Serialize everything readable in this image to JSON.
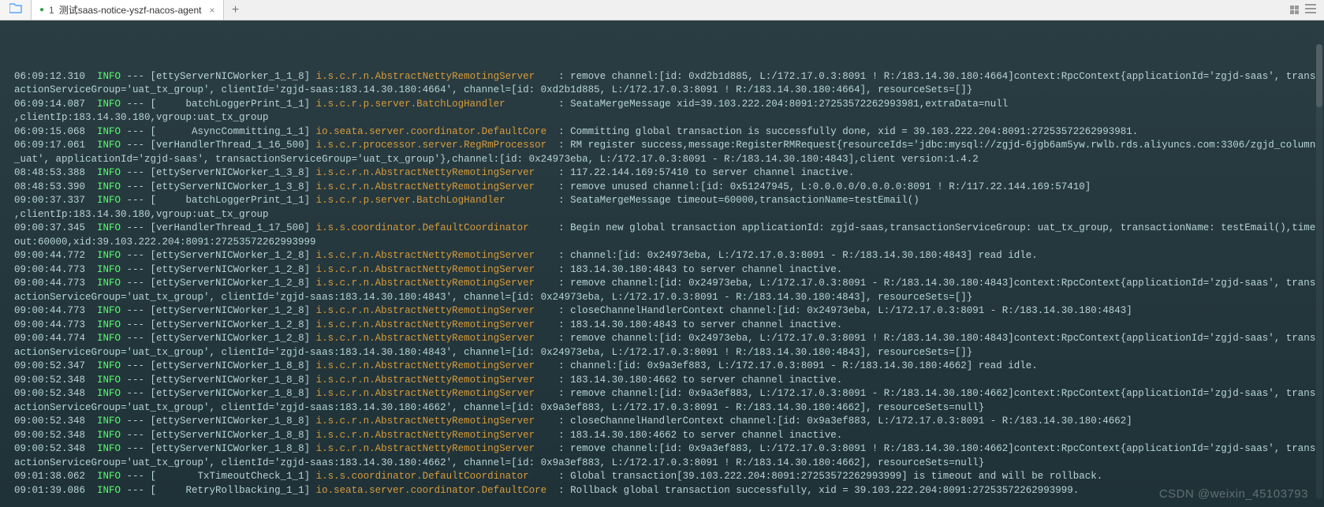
{
  "tab": {
    "badge": "1",
    "title": "测试saas-notice-yszf-nacos-agent"
  },
  "watermark": "CSDN @weixin_45103793",
  "logs": [
    {
      "ts": "06:09:12.310",
      "lvl": "INFO",
      "thr": "[ettyServerNICWorker_1_1_8]",
      "cls": "i.s.c.r.n.AbstractNettyRemotingServer",
      "msg": ": remove channel:[id: 0xd2b1d885, L:/172.17.0.3:8091 ! R:/183.14.30.180:4664]context:RpcContext{applicationId='zgjd-saas', transactionServiceGroup='uat_tx_group', clientId='zgjd-saas:183.14.30.180:4664', channel=[id: 0xd2b1d885, L:/172.17.0.3:8091 ! R:/183.14.30.180:4664], resourceSets=[]}"
    },
    {
      "ts": "06:09:14.087",
      "lvl": "INFO",
      "thr": "[     batchLoggerPrint_1_1]",
      "cls": "i.s.c.r.p.server.BatchLogHandler",
      "msg": ": SeataMergeMessage xid=39.103.222.204:8091:27253572262993981,extraData=null\n,clientIp:183.14.30.180,vgroup:uat_tx_group"
    },
    {
      "ts": "06:09:15.068",
      "lvl": "INFO",
      "thr": "[      AsyncCommitting_1_1]",
      "cls": "io.seata.server.coordinator.DefaultCore",
      "msg": ": Committing global transaction is successfully done, xid = 39.103.222.204:8091:27253572262993981."
    },
    {
      "ts": "06:09:17.061",
      "lvl": "INFO",
      "thr": "[verHandlerThread_1_16_500]",
      "cls": "i.s.c.r.processor.server.RegRmProcessor",
      "msg": ": RM register success,message:RegisterRMRequest{resourceIds='jdbc:mysql://zgjd-6jgb6am5yw.rwlb.rds.aliyuncs.com:3306/zgjd_column_uat', applicationId='zgjd-saas', transactionServiceGroup='uat_tx_group'},channel:[id: 0x24973eba, L:/172.17.0.3:8091 - R:/183.14.30.180:4843],client version:1.4.2"
    },
    {
      "ts": "08:48:53.388",
      "lvl": "INFO",
      "thr": "[ettyServerNICWorker_1_3_8]",
      "cls": "i.s.c.r.n.AbstractNettyRemotingServer",
      "msg": ": 117.22.144.169:57410 to server channel inactive."
    },
    {
      "ts": "08:48:53.390",
      "lvl": "INFO",
      "thr": "[ettyServerNICWorker_1_3_8]",
      "cls": "i.s.c.r.n.AbstractNettyRemotingServer",
      "msg": ": remove unused channel:[id: 0x51247945, L:0.0.0.0/0.0.0.0:8091 ! R:/117.22.144.169:57410]"
    },
    {
      "ts": "09:00:37.337",
      "lvl": "INFO",
      "thr": "[     batchLoggerPrint_1_1]",
      "cls": "i.s.c.r.p.server.BatchLogHandler",
      "msg": ": SeataMergeMessage timeout=60000,transactionName=testEmail()\n,clientIp:183.14.30.180,vgroup:uat_tx_group"
    },
    {
      "ts": "09:00:37.345",
      "lvl": "INFO",
      "thr": "[verHandlerThread_1_17_500]",
      "cls": "i.s.s.coordinator.DefaultCoordinator",
      "msg": ": Begin new global transaction applicationId: zgjd-saas,transactionServiceGroup: uat_tx_group, transactionName: testEmail(),timeout:60000,xid:39.103.222.204:8091:27253572262993999"
    },
    {
      "ts": "09:00:44.772",
      "lvl": "INFO",
      "thr": "[ettyServerNICWorker_1_2_8]",
      "cls": "i.s.c.r.n.AbstractNettyRemotingServer",
      "msg": ": channel:[id: 0x24973eba, L:/172.17.0.3:8091 - R:/183.14.30.180:4843] read idle."
    },
    {
      "ts": "09:00:44.773",
      "lvl": "INFO",
      "thr": "[ettyServerNICWorker_1_2_8]",
      "cls": "i.s.c.r.n.AbstractNettyRemotingServer",
      "msg": ": 183.14.30.180:4843 to server channel inactive."
    },
    {
      "ts": "09:00:44.773",
      "lvl": "INFO",
      "thr": "[ettyServerNICWorker_1_2_8]",
      "cls": "i.s.c.r.n.AbstractNettyRemotingServer",
      "msg": ": remove channel:[id: 0x24973eba, L:/172.17.0.3:8091 - R:/183.14.30.180:4843]context:RpcContext{applicationId='zgjd-saas', transactionServiceGroup='uat_tx_group', clientId='zgjd-saas:183.14.30.180:4843', channel=[id: 0x24973eba, L:/172.17.0.3:8091 - R:/183.14.30.180:4843], resourceSets=[]}"
    },
    {
      "ts": "09:00:44.773",
      "lvl": "INFO",
      "thr": "[ettyServerNICWorker_1_2_8]",
      "cls": "i.s.c.r.n.AbstractNettyRemotingServer",
      "msg": ": closeChannelHandlerContext channel:[id: 0x24973eba, L:/172.17.0.3:8091 - R:/183.14.30.180:4843]"
    },
    {
      "ts": "09:00:44.773",
      "lvl": "INFO",
      "thr": "[ettyServerNICWorker_1_2_8]",
      "cls": "i.s.c.r.n.AbstractNettyRemotingServer",
      "msg": ": 183.14.30.180:4843 to server channel inactive."
    },
    {
      "ts": "09:00:44.774",
      "lvl": "INFO",
      "thr": "[ettyServerNICWorker_1_2_8]",
      "cls": "i.s.c.r.n.AbstractNettyRemotingServer",
      "msg": ": remove channel:[id: 0x24973eba, L:/172.17.0.3:8091 ! R:/183.14.30.180:4843]context:RpcContext{applicationId='zgjd-saas', transactionServiceGroup='uat_tx_group', clientId='zgjd-saas:183.14.30.180:4843', channel=[id: 0x24973eba, L:/172.17.0.3:8091 ! R:/183.14.30.180:4843], resourceSets=[]}"
    },
    {
      "ts": "09:00:52.347",
      "lvl": "INFO",
      "thr": "[ettyServerNICWorker_1_8_8]",
      "cls": "i.s.c.r.n.AbstractNettyRemotingServer",
      "msg": ": channel:[id: 0x9a3ef883, L:/172.17.0.3:8091 - R:/183.14.30.180:4662] read idle."
    },
    {
      "ts": "09:00:52.348",
      "lvl": "INFO",
      "thr": "[ettyServerNICWorker_1_8_8]",
      "cls": "i.s.c.r.n.AbstractNettyRemotingServer",
      "msg": ": 183.14.30.180:4662 to server channel inactive."
    },
    {
      "ts": "09:00:52.348",
      "lvl": "INFO",
      "thr": "[ettyServerNICWorker_1_8_8]",
      "cls": "i.s.c.r.n.AbstractNettyRemotingServer",
      "msg": ": remove channel:[id: 0x9a3ef883, L:/172.17.0.3:8091 - R:/183.14.30.180:4662]context:RpcContext{applicationId='zgjd-saas', transactionServiceGroup='uat_tx_group', clientId='zgjd-saas:183.14.30.180:4662', channel=[id: 0x9a3ef883, L:/172.17.0.3:8091 - R:/183.14.30.180:4662], resourceSets=null}"
    },
    {
      "ts": "09:00:52.348",
      "lvl": "INFO",
      "thr": "[ettyServerNICWorker_1_8_8]",
      "cls": "i.s.c.r.n.AbstractNettyRemotingServer",
      "msg": ": closeChannelHandlerContext channel:[id: 0x9a3ef883, L:/172.17.0.3:8091 - R:/183.14.30.180:4662]"
    },
    {
      "ts": "09:00:52.348",
      "lvl": "INFO",
      "thr": "[ettyServerNICWorker_1_8_8]",
      "cls": "i.s.c.r.n.AbstractNettyRemotingServer",
      "msg": ": 183.14.30.180:4662 to server channel inactive."
    },
    {
      "ts": "09:00:52.348",
      "lvl": "INFO",
      "thr": "[ettyServerNICWorker_1_8_8]",
      "cls": "i.s.c.r.n.AbstractNettyRemotingServer",
      "msg": ": remove channel:[id: 0x9a3ef883, L:/172.17.0.3:8091 ! R:/183.14.30.180:4662]context:RpcContext{applicationId='zgjd-saas', transactionServiceGroup='uat_tx_group', clientId='zgjd-saas:183.14.30.180:4662', channel=[id: 0x9a3ef883, L:/172.17.0.3:8091 ! R:/183.14.30.180:4662], resourceSets=null}"
    },
    {
      "ts": "09:01:38.062",
      "lvl": "INFO",
      "thr": "[       TxTimeoutCheck_1_1]",
      "cls": "i.s.s.coordinator.DefaultCoordinator",
      "msg": ": Global transaction[39.103.222.204:8091:27253572262993999] is timeout and will be rollback."
    },
    {
      "ts": "09:01:39.086",
      "lvl": "INFO",
      "thr": "[     RetryRollbacking_1_1]",
      "cls": "io.seata.server.coordinator.DefaultCore",
      "msg": ": Rollback global transaction successfully, xid = 39.103.222.204:8091:27253572262993999."
    }
  ]
}
